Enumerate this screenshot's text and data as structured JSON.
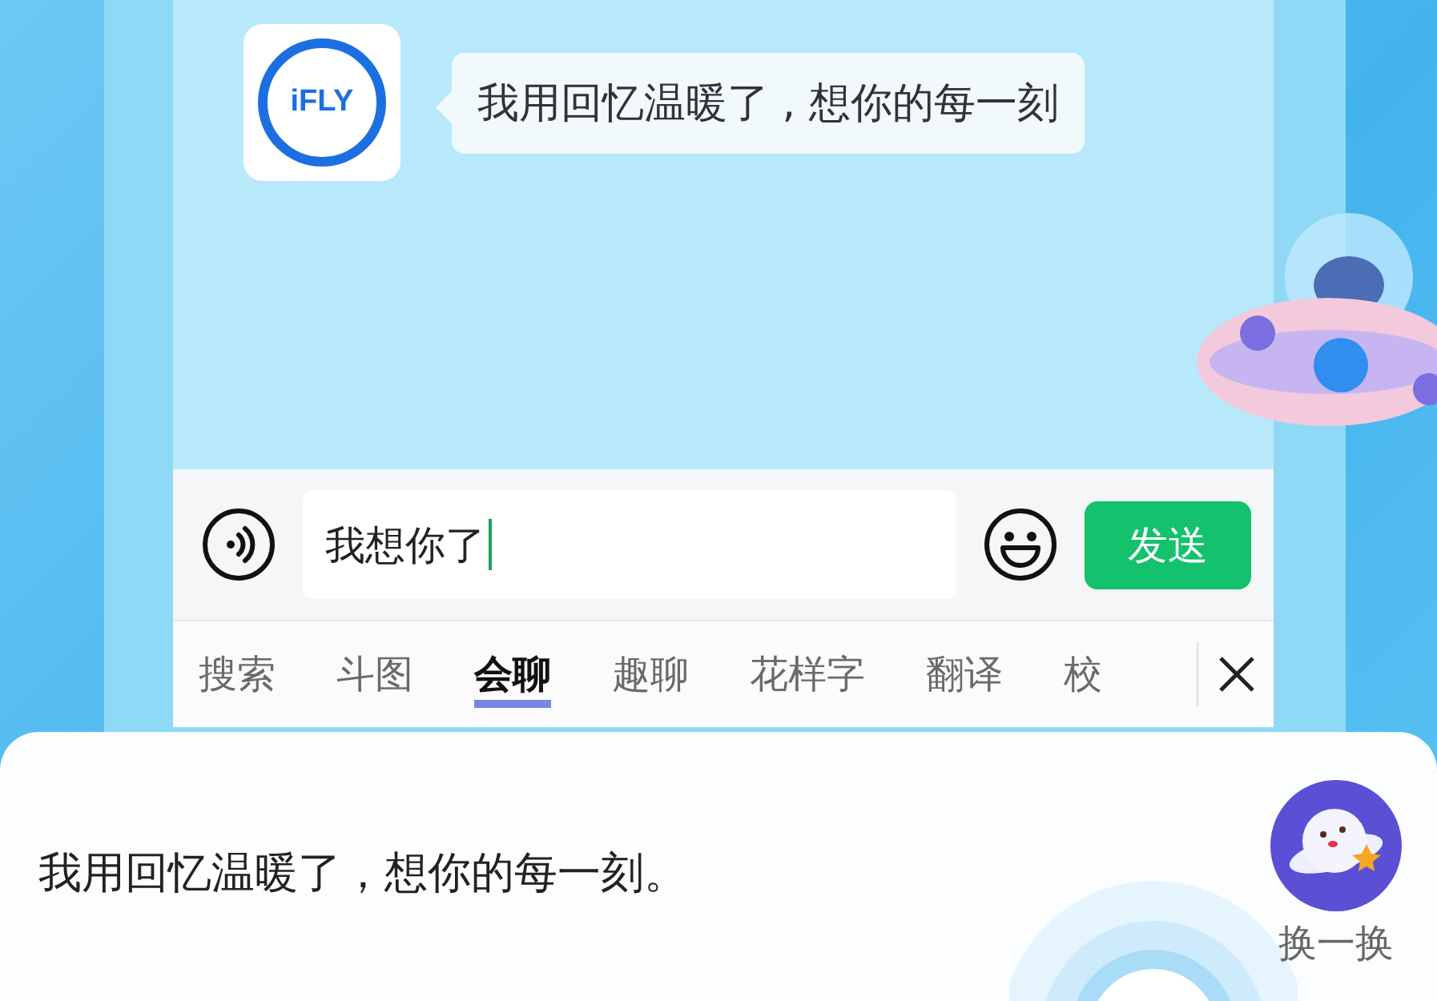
{
  "chat": {
    "logo_text": "iFLY",
    "message": "我用回忆温暖了 , 想你的每一刻"
  },
  "composer": {
    "value": "我想你了",
    "send_label": "发送"
  },
  "tabs": [
    {
      "label": "搜索",
      "selected": false
    },
    {
      "label": "斗图",
      "selected": false
    },
    {
      "label": "会聊",
      "selected": true
    },
    {
      "label": "趣聊",
      "selected": false
    },
    {
      "label": "花样字",
      "selected": false
    },
    {
      "label": "翻译",
      "selected": false
    },
    {
      "label": "校",
      "selected": false
    }
  ],
  "suggestion": {
    "text": "我用回忆温暖了，想你的每一刻。",
    "refresh_label": "换一换"
  }
}
